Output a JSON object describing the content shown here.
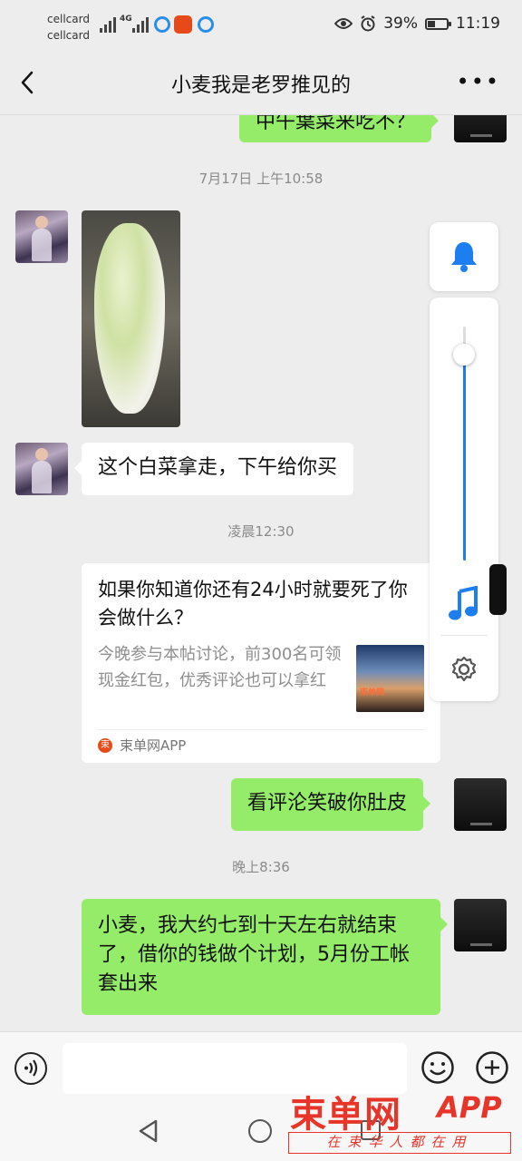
{
  "status_bar": {
    "carrier1": "cellcard",
    "carrier2": "cellcard",
    "net_type": "4G",
    "battery": "39%",
    "time": "11:19",
    "battery_level": 0.39
  },
  "header": {
    "title": "小麦我是老罗推见的"
  },
  "chat": {
    "partial_message": "中午葉菜来吃不？",
    "time1": "7月17日 上午10:58",
    "msg_text1": "这个白菜拿走，下午给你买",
    "time2": "凌晨12:30",
    "card": {
      "title": "如果你知道你还有24小时就要死了你会做什么？",
      "desc": "今晚参与本帖讨论，前300名可领现金红包，优秀评论也可以拿红",
      "thumb_label": "束单网",
      "source_icon": "束",
      "source": "束单网APP"
    },
    "msg_text2": "看评沦笑破你肚皮",
    "time3": "晚上8:36",
    "msg_text3": "小麦，我大约七到十天左右就结束了，借你的钱做个计划，5月份工帐套出来"
  },
  "volume_panel": {
    "level": 0.88,
    "icons": [
      "bell-icon",
      "music-note-icon",
      "gear-icon"
    ]
  },
  "watermark": {
    "logo": "束单网",
    "app": "APP",
    "slogan": "在束华人都在用"
  },
  "colors": {
    "accent": "#1c7ef0",
    "bubble_green": "#95ec69",
    "brand_red": "#e8352a"
  }
}
